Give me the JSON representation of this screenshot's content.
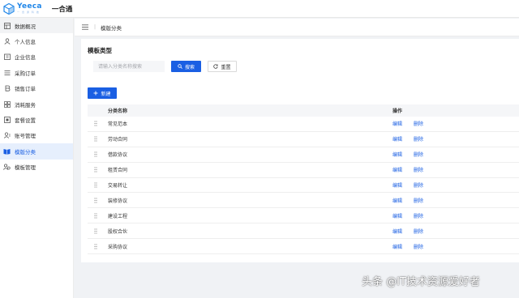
{
  "header": {
    "logo_name": "Yeeca",
    "logo_sub": "一 合 通 科 技",
    "app_title": "一合通"
  },
  "sidebar": {
    "items": [
      {
        "label": "数据概况",
        "icon": "dashboard-icon"
      },
      {
        "label": "个人信息",
        "icon": "user-icon"
      },
      {
        "label": "企业信息",
        "icon": "company-icon"
      },
      {
        "label": "采购订单",
        "icon": "list-icon"
      },
      {
        "label": "销售订单",
        "icon": "bitcoin-icon"
      },
      {
        "label": "消耗服务",
        "icon": "service-icon"
      },
      {
        "label": "套餐设置",
        "icon": "package-icon"
      },
      {
        "label": "账号管理",
        "icon": "account-icon"
      },
      {
        "label": "模版分类",
        "icon": "book-icon",
        "active": true
      },
      {
        "label": "模板管理",
        "icon": "template-icon"
      }
    ]
  },
  "breadcrumb": {
    "current": "模版分类"
  },
  "main": {
    "title": "模板类型",
    "search": {
      "placeholder": "请输入分类名称搜索",
      "value": ""
    },
    "search_button": "搜索",
    "reset_button": "重置",
    "new_button": "新建",
    "table": {
      "headers": {
        "name": "分类名称",
        "ops": "操作"
      },
      "rows": [
        {
          "name": "常见范本",
          "edit": "编辑",
          "del": "删除"
        },
        {
          "name": "劳动合同",
          "edit": "编辑",
          "del": "删除"
        },
        {
          "name": "借款协议",
          "edit": "编辑",
          "del": "删除"
        },
        {
          "name": "租赁合同",
          "edit": "编辑",
          "del": "删除"
        },
        {
          "name": "交易转让",
          "edit": "编辑",
          "del": "删除"
        },
        {
          "name": "装修协议",
          "edit": "编辑",
          "del": "删除"
        },
        {
          "name": "建设工程",
          "edit": "编辑",
          "del": "删除"
        },
        {
          "name": "股权合伙",
          "edit": "编辑",
          "del": "删除"
        },
        {
          "name": "采购协议",
          "edit": "编辑",
          "del": "删除"
        }
      ]
    }
  },
  "watermark": "头条 @IT技术资源爱好者",
  "colors": {
    "accent": "#1a5fe3",
    "active_bg": "#e6effd",
    "logo": "#1f86e8"
  }
}
